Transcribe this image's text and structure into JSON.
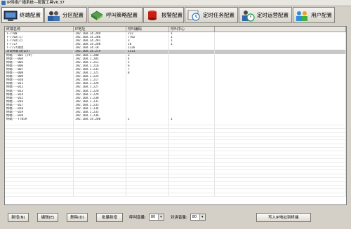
{
  "window": {
    "title": "IP网络广播系统---配置工具V6.37"
  },
  "toolbar": {
    "items": [
      {
        "label": "终端配置",
        "icon": "terminal-icon",
        "active": true
      },
      {
        "label": "分区配置",
        "icon": "users-icon",
        "active": false
      },
      {
        "label": "呼叫策略配置",
        "icon": "book-icon",
        "active": false
      },
      {
        "label": "报警配置",
        "icon": "alarm-icon",
        "active": false
      },
      {
        "label": "定时任务配置",
        "icon": "clock-icon",
        "active": false
      },
      {
        "label": "定时运营配置",
        "icon": "user-clock-icon",
        "active": false
      },
      {
        "label": "用户配置",
        "icon": "user-group-icon",
        "active": false
      }
    ]
  },
  "grid": {
    "columns": [
      "终端名称",
      "IP地址",
      "呼叫编码",
      "呼叫中心",
      ""
    ],
    "rows": [
      [
        "T-7700",
        "192.168.14.209",
        "222",
        "1",
        ""
      ],
      [
        "T-7702(1)",
        "192.168.14.206",
        "7702",
        "1",
        ""
      ],
      [
        "T-7702(2)",
        "192.168.14.201",
        "3",
        "1",
        ""
      ],
      [
        "T-7727",
        "192.168.14.200",
        "10",
        "1",
        ""
      ],
      [
        "T-7727测试",
        "192.168.14.18",
        "1226",
        "",
        ""
      ],
      [
        "测试终端(默认4)",
        "192.168.14.219",
        "1111",
        "",
        ""
      ],
      [
        "终端---002 [79]",
        "192.168.1.200",
        "3",
        "",
        ""
      ],
      [
        "终端---004",
        "192.168.1.205",
        "4",
        "",
        ""
      ],
      [
        "终端---005",
        "192.168.1.211",
        "5",
        "",
        ""
      ],
      [
        "终端---006",
        "192.168.1.216",
        "6",
        "",
        ""
      ],
      [
        "终端---007",
        "192.168.1.232",
        "7",
        "",
        ""
      ],
      [
        "终端---008",
        "192.168.1.221",
        "8",
        "",
        ""
      ],
      [
        "终端---009",
        "192.168.1.224",
        "",
        "",
        ""
      ],
      [
        "终端---010",
        "192.168.1.217",
        "",
        "",
        ""
      ],
      [
        "终端---011",
        "192.168.1.226",
        "",
        "",
        ""
      ],
      [
        "终端---012",
        "192.168.1.227",
        "",
        "",
        ""
      ],
      [
        "终端---013",
        "192.168.1.228",
        "",
        "",
        ""
      ],
      [
        "终端---014",
        "192.168.1.229",
        "",
        "",
        ""
      ],
      [
        "终端---015",
        "192.168.1.230",
        "",
        "",
        ""
      ],
      [
        "终端---016",
        "192.168.1.231",
        "",
        "",
        ""
      ],
      [
        "终端---017",
        "192.168.1.233",
        "",
        "",
        ""
      ],
      [
        "终端---018",
        "192.168.1.234",
        "",
        "",
        ""
      ],
      [
        "终端---019",
        "192.168.1.235",
        "",
        "",
        ""
      ],
      [
        "终端---020",
        "192.168.1.236",
        "",
        "",
        ""
      ],
      [
        "终端---T705A",
        "192.168.14.200",
        "2",
        "1",
        ""
      ]
    ],
    "selected_row": 5,
    "empty_rows": 20
  },
  "bottom": {
    "new_label": "新增(N)",
    "edit_label": "编辑(E)",
    "delete_label": "删除(D)",
    "batch_new_label": "批量新增",
    "call_count_label": "呼叫音量:",
    "call_count_value": "80",
    "bcast_count_label": "对讲音量:",
    "bcast_count_value": "80",
    "import_label": "写入IP地址到终端"
  },
  "colors": {
    "selected_row": "#c7c7c7",
    "window_bg": "#d4d0c8"
  }
}
